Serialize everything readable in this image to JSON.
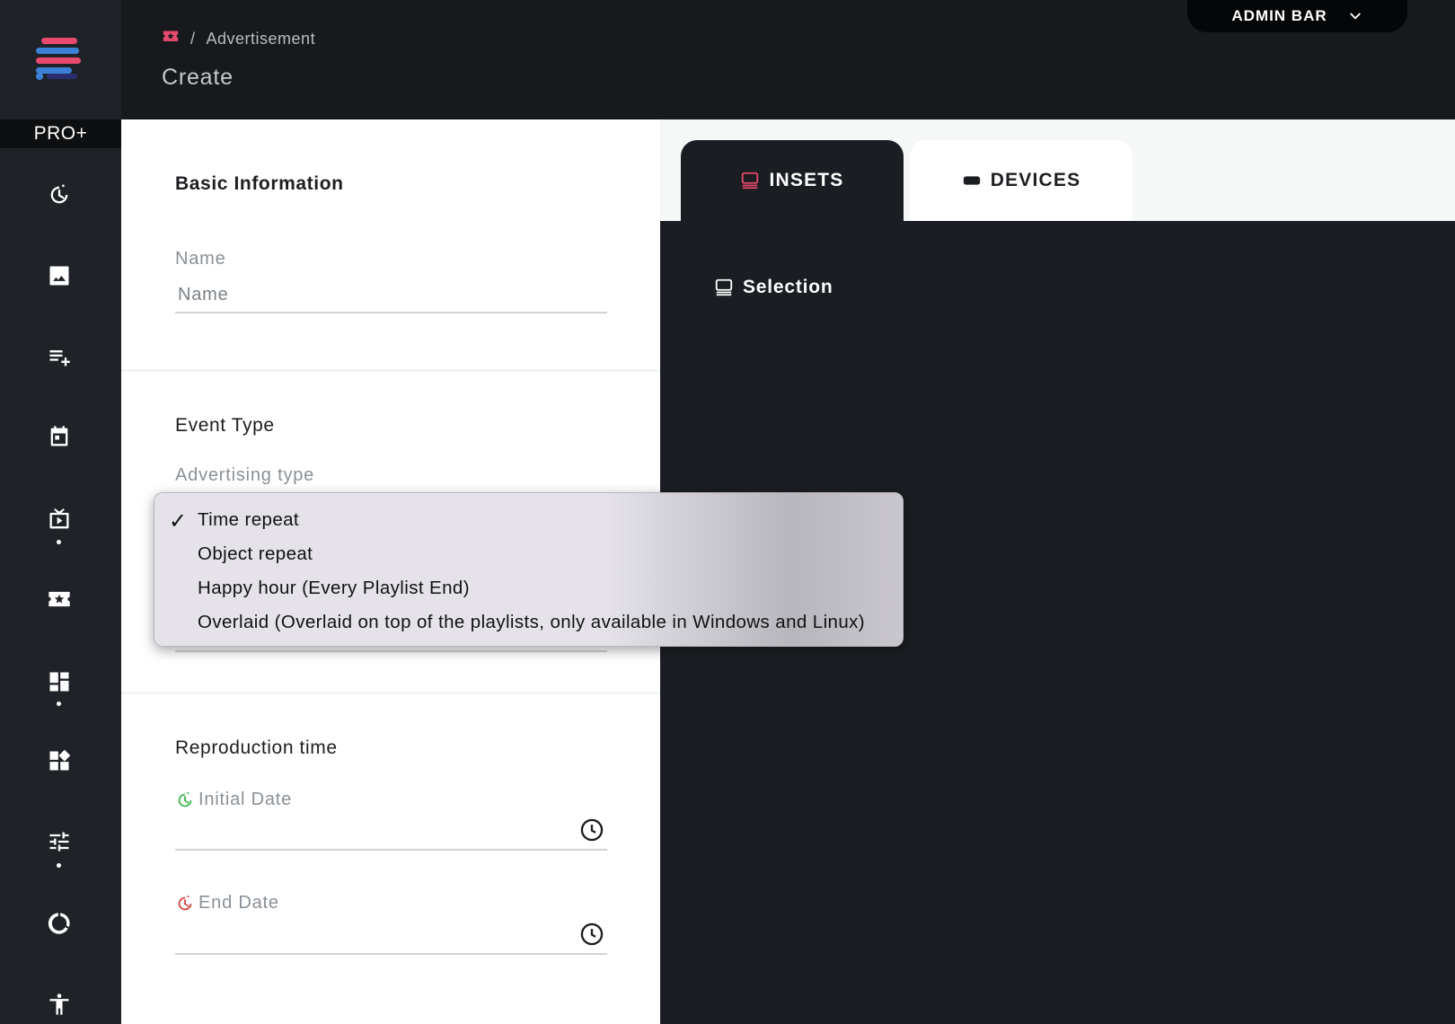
{
  "sidebar": {
    "badge": "PRO+",
    "items": [
      {
        "icon": "timer-icon"
      },
      {
        "icon": "image-icon"
      },
      {
        "icon": "playlist-add-icon"
      },
      {
        "icon": "calendar-icon"
      },
      {
        "icon": "tv-play-icon"
      },
      {
        "icon": "ticket-star-icon"
      },
      {
        "icon": "dashboard-icon"
      },
      {
        "icon": "widgets-icon"
      },
      {
        "icon": "tune-icon"
      },
      {
        "icon": "progress-ring-icon"
      },
      {
        "icon": "accessibility-icon"
      }
    ]
  },
  "header": {
    "breadcrumb_separator": "/",
    "breadcrumb_label": "Advertisement",
    "title": "Create",
    "admin_bar_label": "ADMIN BAR"
  },
  "form": {
    "basic_info_title": "Basic Information",
    "name_label": "Name",
    "name_placeholder": "Name",
    "event_type_title": "Event Type",
    "advertising_type_label": "Advertising type",
    "reproduction_title": "Reproduction time",
    "initial_date_label": "Initial Date",
    "end_date_label": "End Date"
  },
  "tabs": {
    "insets_label": "INSETS",
    "devices_label": "DEVICES",
    "selection_label": "Selection"
  },
  "dropdown": {
    "check_glyph": "✓",
    "options": [
      {
        "label": "Time repeat",
        "selected": true
      },
      {
        "label": "Object repeat",
        "selected": false
      },
      {
        "label": "Happy hour (Every Playlist End)",
        "selected": false
      },
      {
        "label": "Overlaid (Overlaid on top of the playlists, only available in Windows and Linux)",
        "selected": false
      }
    ]
  },
  "colors": {
    "accent": "#e84a6f",
    "start_green": "#3fb950",
    "end_red": "#d64545",
    "dark_bg": "#1a1d21"
  }
}
